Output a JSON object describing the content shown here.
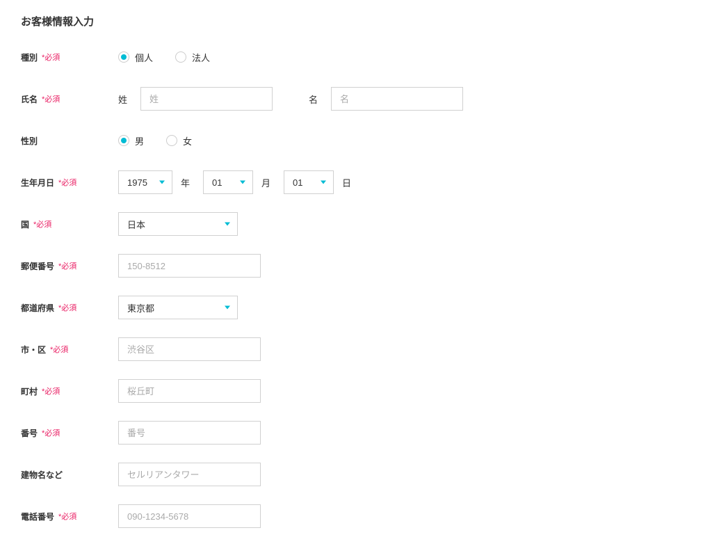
{
  "title": "お客様情報入力",
  "required_text": "*必須",
  "labels": {
    "type": "種別",
    "name": "氏名",
    "gender": "性別",
    "birthday": "生年月日",
    "country": "国",
    "postal": "郵便番号",
    "prefecture": "都道府県",
    "city": "市・区",
    "town": "町村",
    "number": "番号",
    "building": "建物名など",
    "tel": "電話番号"
  },
  "type": {
    "individual": "個人",
    "corporation": "法人"
  },
  "name": {
    "last_label": "姓",
    "last_placeholder": "姓",
    "first_label": "名",
    "first_placeholder": "名"
  },
  "gender": {
    "male": "男",
    "female": "女"
  },
  "birthday": {
    "year": "1975",
    "year_unit": "年",
    "month": "01",
    "month_unit": "月",
    "day": "01",
    "day_unit": "日"
  },
  "country": {
    "value": "日本"
  },
  "postal": {
    "placeholder": "150-8512"
  },
  "prefecture": {
    "value": "東京都"
  },
  "city": {
    "placeholder": "渋谷区"
  },
  "town": {
    "placeholder": "桜丘町"
  },
  "number": {
    "placeholder": "番号"
  },
  "building": {
    "placeholder": "セルリアンタワー"
  },
  "tel": {
    "placeholder": "090-1234-5678"
  }
}
